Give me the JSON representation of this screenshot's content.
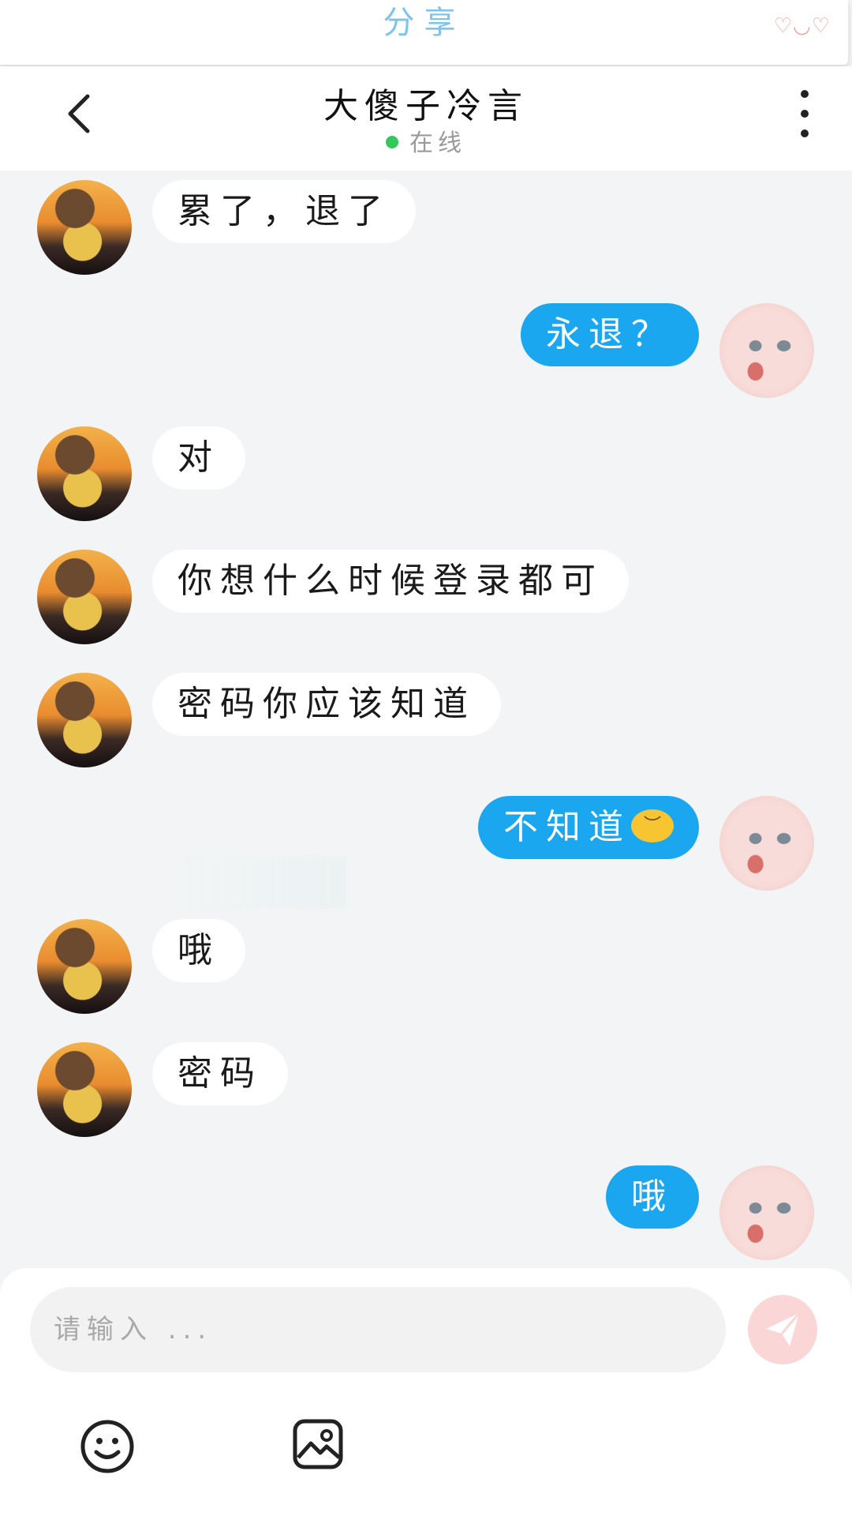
{
  "topbar": {
    "share_label": "分享",
    "deco": "♡◡♡"
  },
  "header": {
    "title": "大傻子冷言",
    "status": "在线"
  },
  "messages": [
    {
      "side": "left",
      "text": "累了，退了"
    },
    {
      "side": "right",
      "text": "永退？"
    },
    {
      "side": "left",
      "text": "对"
    },
    {
      "side": "left",
      "text": "你想什么时候登录都可"
    },
    {
      "side": "left",
      "text": "密码你应该知道"
    },
    {
      "side": "right",
      "text": "不知道",
      "emoji": "worried-emoji"
    },
    {
      "side": "left",
      "text": "哦"
    },
    {
      "side": "left",
      "text": "密码",
      "note": "partially blurred"
    },
    {
      "side": "right",
      "text": "哦"
    }
  ],
  "composer": {
    "placeholder": "请输入 ..."
  },
  "colors": {
    "accent": "#1aa7ef",
    "online": "#34c759",
    "send": "#fbd6d6"
  }
}
